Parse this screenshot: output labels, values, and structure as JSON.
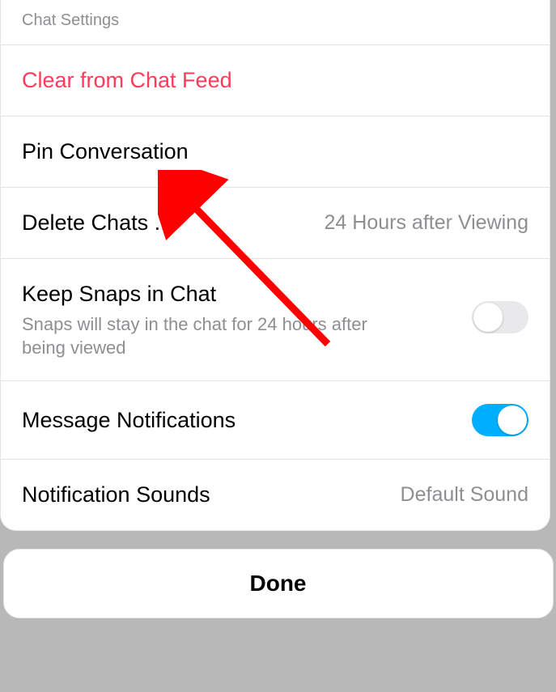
{
  "header": "Chat Settings",
  "rows": {
    "clear": {
      "label": "Clear from Chat Feed"
    },
    "pin": {
      "label": "Pin Conversation"
    },
    "deleteChats": {
      "label": "Delete Chats ...",
      "value": "24 Hours after Viewing"
    },
    "keepSnaps": {
      "label": "Keep Snaps in Chat",
      "sublabel": "Snaps will stay in the chat for 24 hours after being viewed"
    },
    "messageNotifications": {
      "label": "Message Notifications"
    },
    "notificationSounds": {
      "label": "Notification Sounds",
      "value": "Default Sound"
    }
  },
  "done": "Done",
  "colors": {
    "danger": "#ff3b5c",
    "toggleOn": "#00aeff",
    "arrow": "#ff0000"
  }
}
